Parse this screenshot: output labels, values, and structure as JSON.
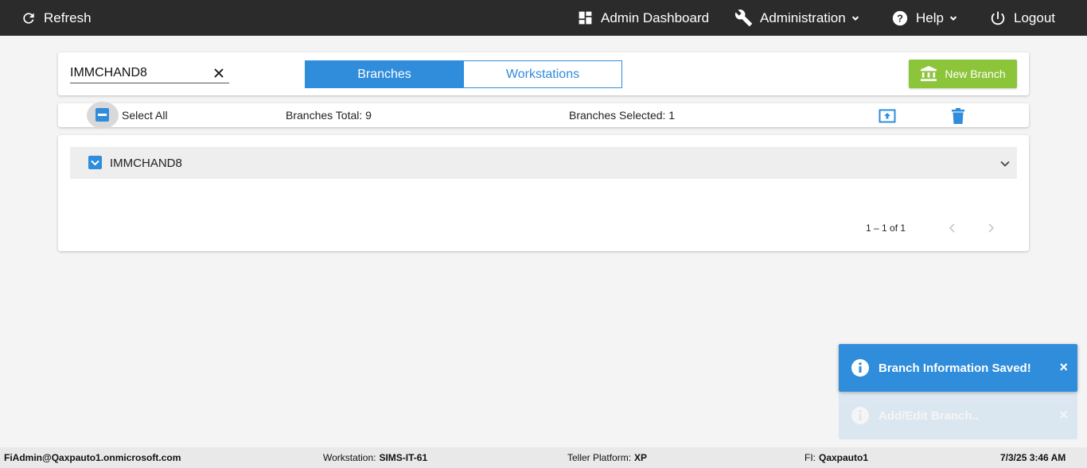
{
  "topbar": {
    "refresh_label": "Refresh",
    "admin_dashboard_label": "Admin Dashboard",
    "administration_label": "Administration",
    "help_label": "Help",
    "logout_label": "Logout"
  },
  "search": {
    "value": "IMMCHAND8"
  },
  "view_toggle": {
    "branches_label": "Branches",
    "workstations_label": "Workstations",
    "active": "Branches"
  },
  "new_branch_label": "New Branch",
  "toolbar": {
    "select_all_label": "Select All",
    "branches_total": "Branches Total: 9",
    "branches_selected": "Branches Selected: 1"
  },
  "branches": [
    {
      "name": "IMMCHAND8",
      "selected": true
    }
  ],
  "pagination": {
    "range_label": "1 – 1 of 1"
  },
  "toasts": [
    {
      "message": "Branch Information Saved!",
      "close": "×"
    },
    {
      "message": "Add/Edit Branch..",
      "close": "×"
    }
  ],
  "status": {
    "user": "FiAdmin@Qaxpauto1.onmicrosoft.com",
    "workstation_label": "Workstation:",
    "workstation_value": "SIMS-IT-61",
    "teller_label": "Teller Platform:",
    "teller_value": "XP",
    "fi_label": "FI:",
    "fi_value": "Qaxpauto1",
    "datetime": "7/3/25 3:46 AM"
  },
  "colors": {
    "primary": "#2f8ddb",
    "success": "#8cc43a",
    "topbar": "#2b2b2b"
  }
}
